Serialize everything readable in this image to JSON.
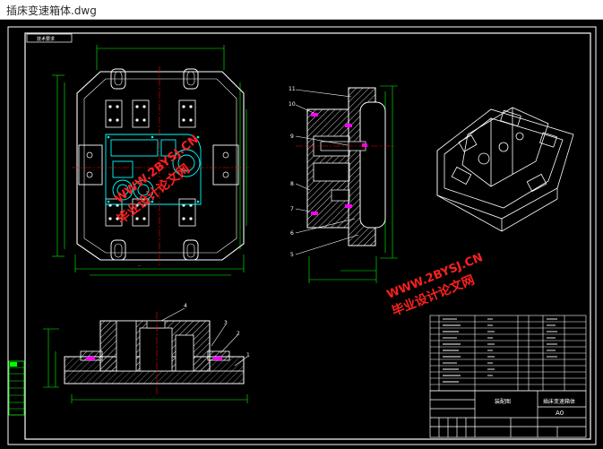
{
  "window": {
    "title": "插床变速箱体.dwg"
  },
  "drawing": {
    "tag_label": "技术要求",
    "watermarks": [
      {
        "line1": "毕业设计论文网",
        "line2": "WWW.2BYSJ.CN"
      },
      {
        "line1": "毕业设计论文网",
        "line2": "WWW.2BYSJ.CN"
      }
    ],
    "balloons_side": [
      "11",
      "10",
      "9",
      "8",
      "7",
      "6",
      "5"
    ],
    "balloons_bottom": [
      "4",
      "3",
      "2",
      "1"
    ],
    "title_block": {
      "company": "装配图",
      "drawing_name": "插床变速箱体",
      "sheet": "A0"
    },
    "colors": {
      "background": "#000000",
      "frame": "#ffffff",
      "geometry": "#ffffff",
      "dimension": "#00ff00",
      "centerline": "#ff0000",
      "cyan": "#00ffff",
      "magenta": "#ff00ff",
      "hatch": "#ffffff",
      "watermark": "#ff2020"
    }
  }
}
